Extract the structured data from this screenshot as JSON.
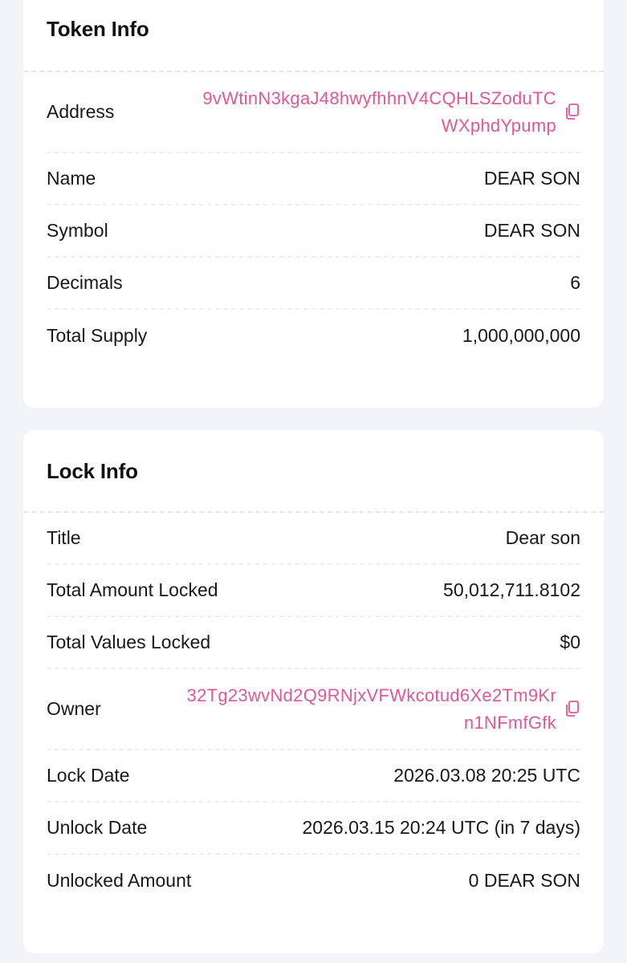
{
  "token_info": {
    "title": "Token Info",
    "rows": [
      {
        "label": "Address",
        "value_line1": "9vWtinN3kgaJ48hwyfhhnV4CQHLSZoduTC",
        "value_line2": "WXphdYpump"
      },
      {
        "label": "Name",
        "value": "DEAR SON"
      },
      {
        "label": "Symbol",
        "value": "DEAR SON"
      },
      {
        "label": "Decimals",
        "value": "6"
      },
      {
        "label": "Total Supply",
        "value": "1,000,000,000"
      }
    ]
  },
  "lock_info": {
    "title": "Lock Info",
    "rows": [
      {
        "label": "Title",
        "value": "Dear son"
      },
      {
        "label": "Total Amount Locked",
        "value": "50,012,711.8102"
      },
      {
        "label": "Total Values Locked",
        "value": "$0"
      },
      {
        "label": "Owner",
        "value_line1": "32Tg23wvNd2Q9RNjxVFWkcotud6Xe2Tm9Kr",
        "value_line2": "n1NFmfGfk"
      },
      {
        "label": "Lock Date",
        "value": "2026.03.08 20:25 UTC"
      },
      {
        "label": "Unlock Date",
        "value": "2026.03.15 20:24 UTC (in 7 days)"
      },
      {
        "label": "Unlocked Amount",
        "value": "0 DEAR SON"
      }
    ]
  },
  "colors": {
    "accent": "#e0579a",
    "background": "#f3f4f7",
    "card": "#ffffff",
    "text": "#17181a"
  },
  "icons": {
    "copy": "copy-icon"
  }
}
